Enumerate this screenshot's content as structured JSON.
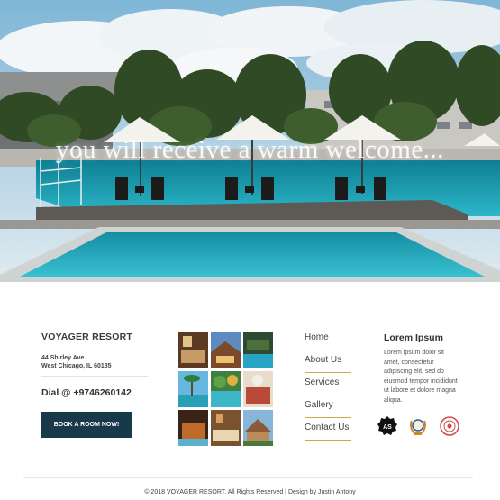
{
  "hero": {
    "tagline": "you will receive a warm welcome..."
  },
  "contact": {
    "brand": "VOYAGER RESORT",
    "address_line1": "44 Shirley Ave.",
    "address_line2": "West Chicago, IL 60185",
    "phone": "Dial @ +9746260142",
    "book_button": "BOOK A ROOM NOW!"
  },
  "gallery": {
    "photos": [
      "room-photo",
      "resort-exterior-photo",
      "pool-photo",
      "beach-palms-photo",
      "pool-garden-photo",
      "spa-photo",
      "cabin-photo",
      "room-interior-photo",
      "lodge-photo"
    ]
  },
  "nav": {
    "items": [
      "Home",
      "About Us",
      "Services",
      "Gallery",
      "Contact Us"
    ]
  },
  "lorem": {
    "title": "Lorem Ipsum",
    "text": "Lorem ipsum dolor sit amet, consectetur adipiscing elit, sed do eiusmod tempor incididunt ut labore et dolore magna aliqua.",
    "badge_icons": [
      "as-certification-badge-icon",
      "laurel-award-badge-icon",
      "red-seal-badge-icon"
    ]
  },
  "footer": {
    "copyright": "© 2018 VOYAGER RESORT. All Rights Reserved | Design by Justin Antony"
  },
  "colors": {
    "button_bg": "#17394a",
    "nav_underline": "#c9a94a",
    "pool": "#1fa3b8"
  }
}
